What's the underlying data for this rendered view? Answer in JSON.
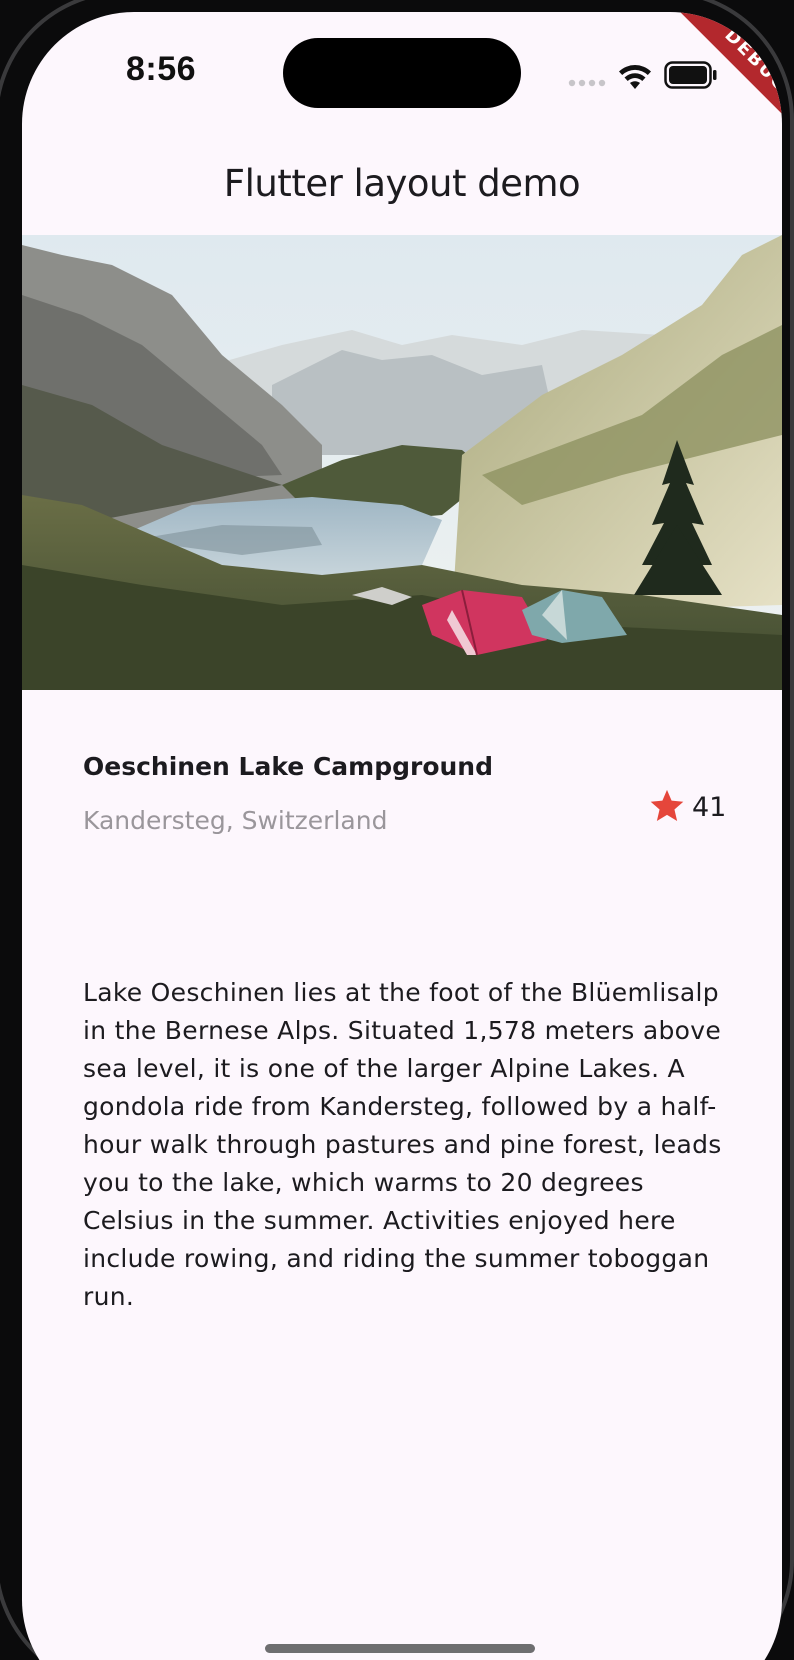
{
  "status_bar": {
    "time": "8:56",
    "icons": [
      "cellular-signal-icon",
      "wifi-icon",
      "battery-icon"
    ]
  },
  "debug_banner": "DEBUG",
  "app_bar": {
    "title": "Flutter layout demo"
  },
  "hero_image": {
    "subject": "mountain-lake-with-tents"
  },
  "place": {
    "title": "Oeschinen Lake Campground",
    "subtitle": "Kandersteg, Switzerland",
    "favorite_count": "41",
    "favorite_icon": "star-icon",
    "favorite_color": "#e5463b"
  },
  "description": "Lake Oeschinen lies at the foot of the Blüemlisalp in the Bernese Alps. Situated 1,578 meters above sea level, it is one of the larger Alpine Lakes. A gondola ride from Kandersteg, followed by a half-hour walk through pastures and pine forest, leads you to the lake, which warms to 20 degrees Celsius in the summer. Activities enjoyed here include rowing, and riding the summer toboggan run.",
  "colors": {
    "background": "#fdf7fd",
    "text": "#1c1b1f",
    "subtitle": "#9a969b",
    "debug": "#b3282d"
  }
}
